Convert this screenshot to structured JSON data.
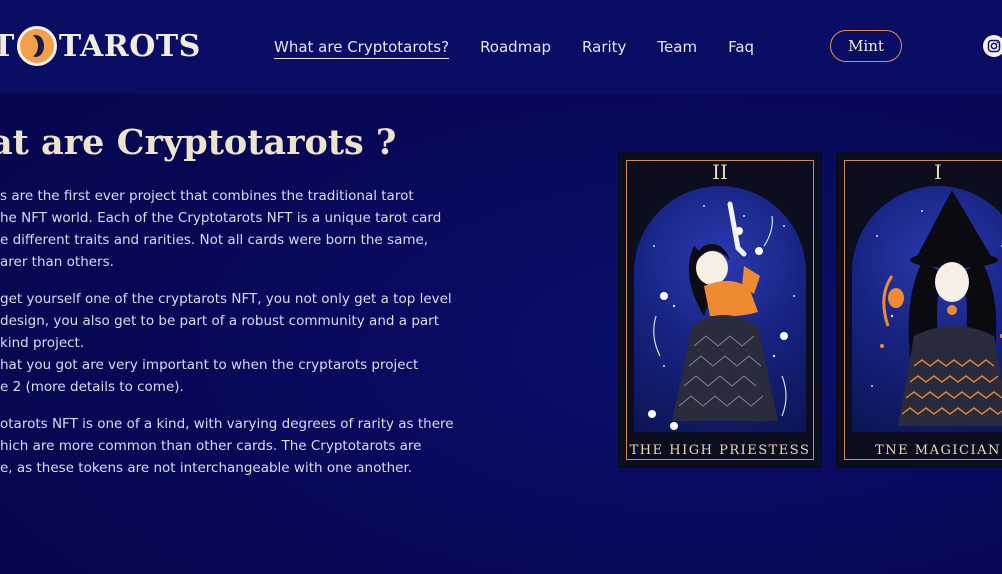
{
  "header": {
    "logo_text": "TAROTS",
    "logo_prefix": "T",
    "nav": [
      "What are Cryptotarots?",
      "Roadmap",
      "Rarity",
      "Team",
      "Faq"
    ],
    "mint_label": "Mint"
  },
  "main": {
    "title": "at are Cryptotarots ?",
    "paragraph1": [
      "s are the first ever project that combines the traditional tarot",
      "he NFT world. Each of the Cryptotarots NFT is a unique tarot card",
      "e different traits and rarities. Not all cards were born the same,",
      "arer than others."
    ],
    "paragraph2": [
      "get yourself one of the cryptarots NFT, you not only get a top level",
      "design, you also get to be part of a robust community and a part",
      "kind project.",
      "hat you got are very important to when the cryptarots project",
      "e 2 (more details to come)."
    ],
    "paragraph3": [
      "otarots NFT is one of a kind, with varying degrees of rarity as there",
      "hich are more common than other cards. The Cryptotarots are",
      "e, as these tokens are not interchangeable with one another."
    ]
  },
  "cards": [
    {
      "numeral": "II",
      "name": "THE HIGH PRIESTESS"
    },
    {
      "numeral": "I",
      "name": "TNE MAGICIAN"
    }
  ],
  "colors": {
    "accent": "#e8894c",
    "title": "#efe3cc",
    "background": "#07095a"
  }
}
